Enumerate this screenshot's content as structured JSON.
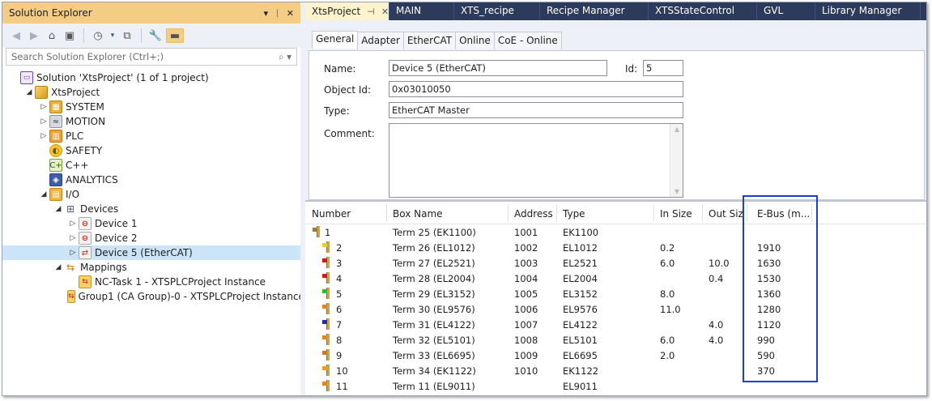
{
  "solution_explorer": {
    "title": "Solution Explorer",
    "title_controls": [
      "▾",
      "ᛁ",
      "✕"
    ],
    "search_placeholder": "Search Solution Explorer (Ctrl+;)",
    "tree": [
      {
        "label": "Solution 'XtsProject' (1 of 1 project)",
        "icon": "solution-icon",
        "indent": 0,
        "arrow": ""
      },
      {
        "label": "XtsProject",
        "icon": "project-icon",
        "indent": 1,
        "arrow": "◢"
      },
      {
        "label": "SYSTEM",
        "icon": "system-icon",
        "indent": 2,
        "arrow": "▷"
      },
      {
        "label": "MOTION",
        "icon": "motion-icon",
        "indent": 2,
        "arrow": "▷"
      },
      {
        "label": "PLC",
        "icon": "plc-icon",
        "indent": 2,
        "arrow": "▷"
      },
      {
        "label": "SAFETY",
        "icon": "safety-icon",
        "indent": 2,
        "arrow": ""
      },
      {
        "label": "C++",
        "icon": "cpp-icon",
        "indent": 2,
        "arrow": ""
      },
      {
        "label": "ANALYTICS",
        "icon": "analytics-icon",
        "indent": 2,
        "arrow": ""
      },
      {
        "label": "I/O",
        "icon": "io-icon",
        "indent": 2,
        "arrow": "◢"
      },
      {
        "label": "Devices",
        "icon": "devices-icon",
        "indent": 3,
        "arrow": "◢"
      },
      {
        "label": "Device 1",
        "icon": "device-icon",
        "indent": 4,
        "arrow": "▷"
      },
      {
        "label": "Device 2",
        "icon": "device-icon",
        "indent": 4,
        "arrow": "▷"
      },
      {
        "label": "Device 5 (EtherCAT)",
        "icon": "ethercat-device-icon",
        "indent": 4,
        "arrow": "▷",
        "selected": true
      },
      {
        "label": "Mappings",
        "icon": "mappings-icon",
        "indent": 3,
        "arrow": "◢"
      },
      {
        "label": "NC-Task 1 - XTSPLCProject Instance",
        "icon": "mapping-item-icon",
        "indent": 4,
        "arrow": ""
      },
      {
        "label": "Group1 (CA Group)-0 - XTSPLCProject Instance",
        "icon": "mapping-item-icon",
        "indent": 4,
        "arrow": ""
      }
    ]
  },
  "document_tabs": [
    {
      "label": "XtsProject",
      "active": true
    },
    {
      "label": "MAIN"
    },
    {
      "label": "XTS_recipe"
    },
    {
      "label": "Recipe Manager"
    },
    {
      "label": "XTSStateControl"
    },
    {
      "label": "GVL"
    },
    {
      "label": "Library Manager"
    }
  ],
  "property_tabs": [
    "General",
    "Adapter",
    "EtherCAT",
    "Online",
    "CoE - Online"
  ],
  "general": {
    "name_label": "Name:",
    "name_value": "Device 5 (EtherCAT)",
    "id_label": "Id:",
    "id_value": "5",
    "object_id_label": "Object Id:",
    "object_id_value": "0x03010050",
    "type_label": "Type:",
    "type_value": "EtherCAT Master",
    "comment_label": "Comment:",
    "comment_value": ""
  },
  "terminal_table": {
    "columns": [
      "Number",
      "Box Name",
      "Address",
      "Type",
      "In Size",
      "Out Size",
      "E-Bus (m..."
    ],
    "rows": [
      {
        "number": "1",
        "box": "Term 25 (EK1100)",
        "address": "1001",
        "type": "EK1100",
        "in": "",
        "out": "",
        "ebus": "",
        "led": "#9b7a3a"
      },
      {
        "number": "2",
        "box": "Term 26 (EL1012)",
        "address": "1002",
        "type": "EL1012",
        "in": "0.2",
        "out": "",
        "ebus": "1910",
        "led": "#e8d21a"
      },
      {
        "number": "3",
        "box": "Term 27 (EL2521)",
        "address": "1003",
        "type": "EL2521",
        "in": "6.0",
        "out": "10.0",
        "ebus": "1630",
        "led": "#d41818"
      },
      {
        "number": "4",
        "box": "Term 28 (EL2004)",
        "address": "1004",
        "type": "EL2004",
        "in": "",
        "out": "0.4",
        "ebus": "1530",
        "led": "#d41818"
      },
      {
        "number": "5",
        "box": "Term 29 (EL3152)",
        "address": "1005",
        "type": "EL3152",
        "in": "8.0",
        "out": "",
        "ebus": "1360",
        "led": "#22c422"
      },
      {
        "number": "6",
        "box": "Term 30 (EL9576)",
        "address": "1006",
        "type": "EL9576",
        "in": "11.0",
        "out": "",
        "ebus": "1280",
        "led": "#e8841a"
      },
      {
        "number": "7",
        "box": "Term 31 (EL4122)",
        "address": "1007",
        "type": "EL4122",
        "in": "",
        "out": "4.0",
        "ebus": "1120",
        "led": "#1a2fb4"
      },
      {
        "number": "8",
        "box": "Term 32 (EL5101)",
        "address": "1008",
        "type": "EL5101",
        "in": "6.0",
        "out": "4.0",
        "ebus": "990",
        "led": "#e8841a"
      },
      {
        "number": "9",
        "box": "Term 33 (EL6695)",
        "address": "1009",
        "type": "EL6695",
        "in": "2.0",
        "out": "",
        "ebus": "590",
        "led": "#c87a2a"
      },
      {
        "number": "10",
        "box": "Term 34 (EK1122)",
        "address": "1010",
        "type": "EK1122",
        "in": "",
        "out": "",
        "ebus": "370",
        "led": "#e8a21a"
      },
      {
        "number": "11",
        "box": "Term 11 (EL9011)",
        "address": "",
        "type": "EL9011",
        "in": "",
        "out": "",
        "ebus": "",
        "led": "#e8841a"
      }
    ]
  },
  "colors": {
    "title_bar": "#f5cc84",
    "selection": "#cce4f7",
    "tab_strip": "#2c3b5c",
    "active_tab": "#fff3cd",
    "highlight_box": "#1a3fd6"
  }
}
